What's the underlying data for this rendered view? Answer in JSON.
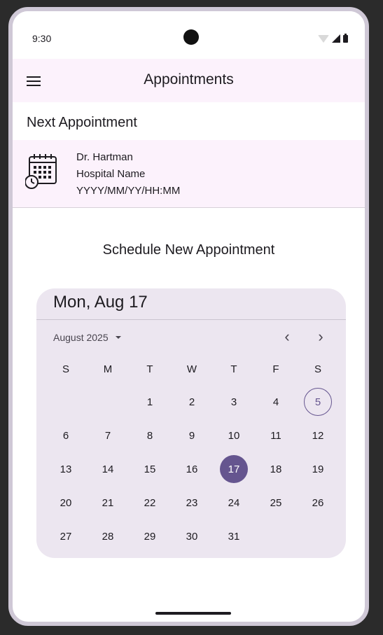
{
  "status_bar": {
    "time": "9:30"
  },
  "app_bar": {
    "title": "Appointments"
  },
  "next_appointment": {
    "section_title": "Next Appointment",
    "doctor": "Dr. Hartman",
    "hospital": "Hospital Name",
    "datetime": "YYYY/MM/YY/HH:MM"
  },
  "schedule": {
    "title": "Schedule New Appointment"
  },
  "date_picker": {
    "header": "Mon, Aug 17",
    "month_label": "August 2025",
    "prev_label": "‹",
    "next_label": "›",
    "weekdays": [
      "S",
      "M",
      "T",
      "W",
      "T",
      "F",
      "S"
    ],
    "weeks": [
      [
        "",
        "",
        "1",
        "2",
        "3",
        "4",
        "5"
      ],
      [
        "6",
        "7",
        "8",
        "9",
        "10",
        "11",
        "12"
      ],
      [
        "13",
        "14",
        "15",
        "16",
        "17",
        "18",
        "19"
      ],
      [
        "20",
        "21",
        "22",
        "23",
        "24",
        "25",
        "26"
      ],
      [
        "27",
        "28",
        "29",
        "30",
        "31",
        "",
        ""
      ]
    ],
    "today": "5",
    "selected": "17"
  },
  "colors": {
    "accent": "#65558f",
    "surface_tint": "#fcf2fc",
    "picker_bg": "#ece6f0"
  }
}
